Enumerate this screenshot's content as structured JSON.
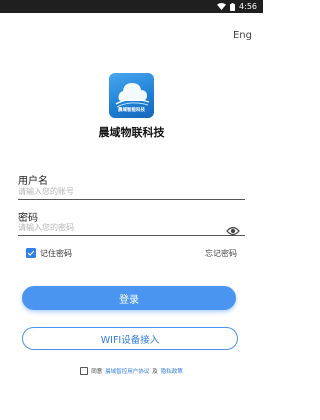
{
  "status_bar": {
    "time": "4:56"
  },
  "language_toggle": "Eng",
  "app": {
    "logo_text": "晨域智能科技",
    "brand_name": "晨域物联科技"
  },
  "login_form": {
    "username": {
      "label": "用户名",
      "placeholder": "请输入您的账号",
      "value": ""
    },
    "password": {
      "label": "密码",
      "placeholder": "请输入您的密码",
      "value": ""
    },
    "remember_label": "记住密码",
    "remember_checked": true,
    "forgot_label": "忘记密码",
    "login_button": "登录",
    "wifi_button": "WIFI设备接入"
  },
  "agreement": {
    "checked": false,
    "prefix": "同意",
    "user_agreement": "晨域智控用户协议",
    "conjunction": "及",
    "privacy_policy": "隐私政策"
  },
  "colors": {
    "primary": "#4a95ef",
    "checkbox": "#2f80e8",
    "status_bar": "#1f1f1f"
  }
}
